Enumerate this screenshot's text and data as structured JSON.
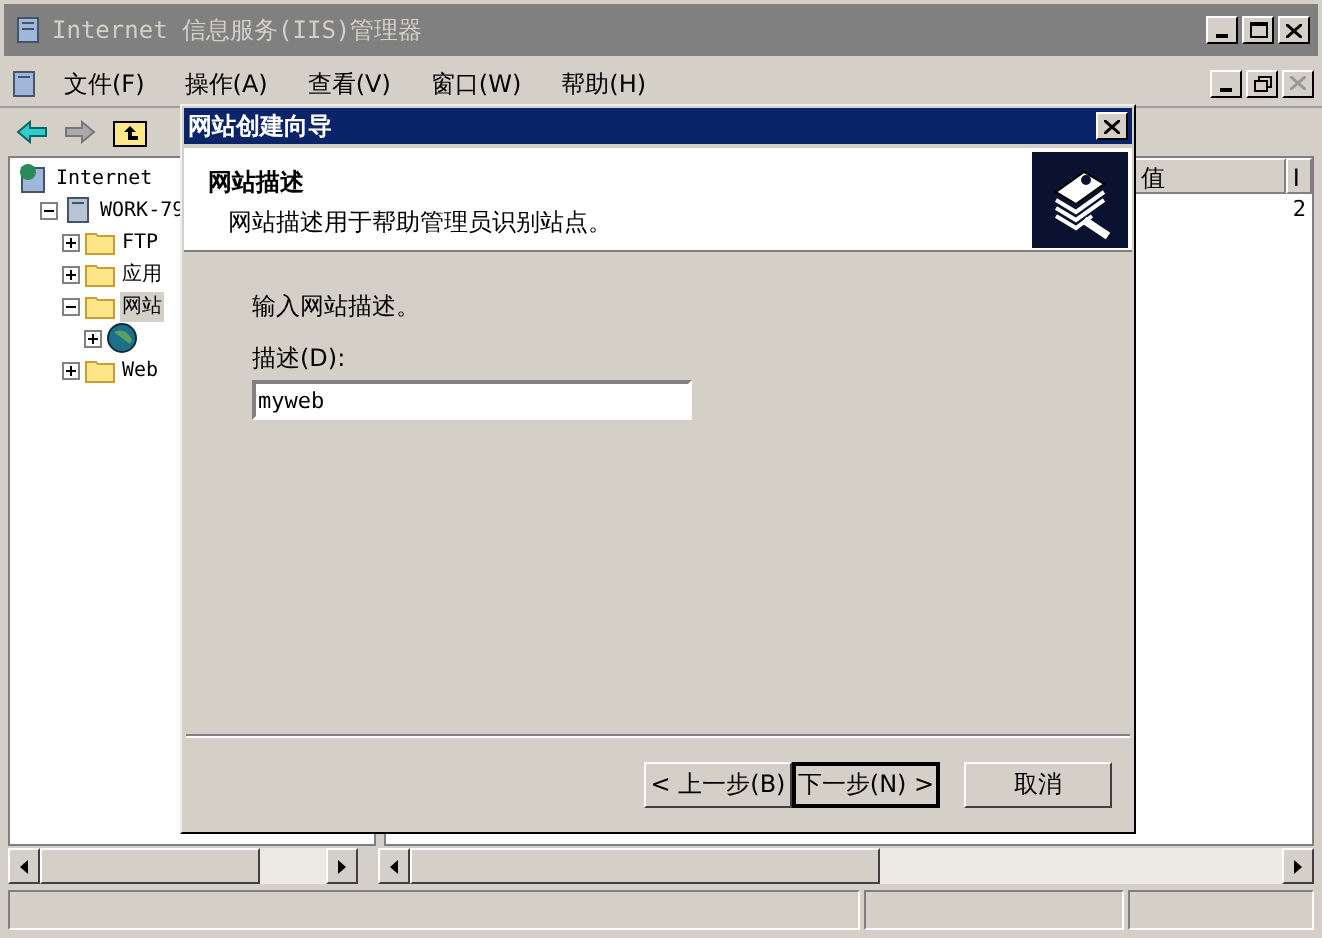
{
  "window": {
    "title": "Internet 信息服务(IIS)管理器",
    "active": false
  },
  "menu": [
    {
      "label": "文件(F)"
    },
    {
      "label": "操作(A)"
    },
    {
      "label": "查看(V)"
    },
    {
      "label": "窗口(W)"
    },
    {
      "label": "帮助(H)"
    }
  ],
  "tree": [
    {
      "kind": "root",
      "label": "Internet",
      "children": [
        {
          "kind": "computer",
          "label": "WORK-79",
          "expanded": true,
          "children": [
            {
              "kind": "folder",
              "label": "FTP",
              "expanded": false
            },
            {
              "kind": "folder",
              "label": "应用",
              "expanded": false
            },
            {
              "kind": "folder",
              "label": "网站",
              "expanded": true,
              "selected": true,
              "children": [
                {
                  "kind": "globe",
                  "expanded": false
                }
              ]
            },
            {
              "kind": "folder",
              "label": "Web",
              "expanded": false
            }
          ]
        }
      ]
    }
  ],
  "table": {
    "columns": [
      "值",
      "I"
    ],
    "rows": [
      {
        "column_2": "2"
      }
    ]
  },
  "dialog": {
    "title": "网站创建向导",
    "header_title": "网站描述",
    "header_subtitle": "网站描述用于帮助管理员识别站点。",
    "prompt": "输入网站描述。",
    "field_label": "描述(D):",
    "field_value": "myweb",
    "buttons": [
      {
        "label": "< 上一步(B)",
        "default": false
      },
      {
        "label": "下一步(N) >",
        "default": true
      },
      {
        "label": "取消",
        "default": false
      }
    ]
  }
}
